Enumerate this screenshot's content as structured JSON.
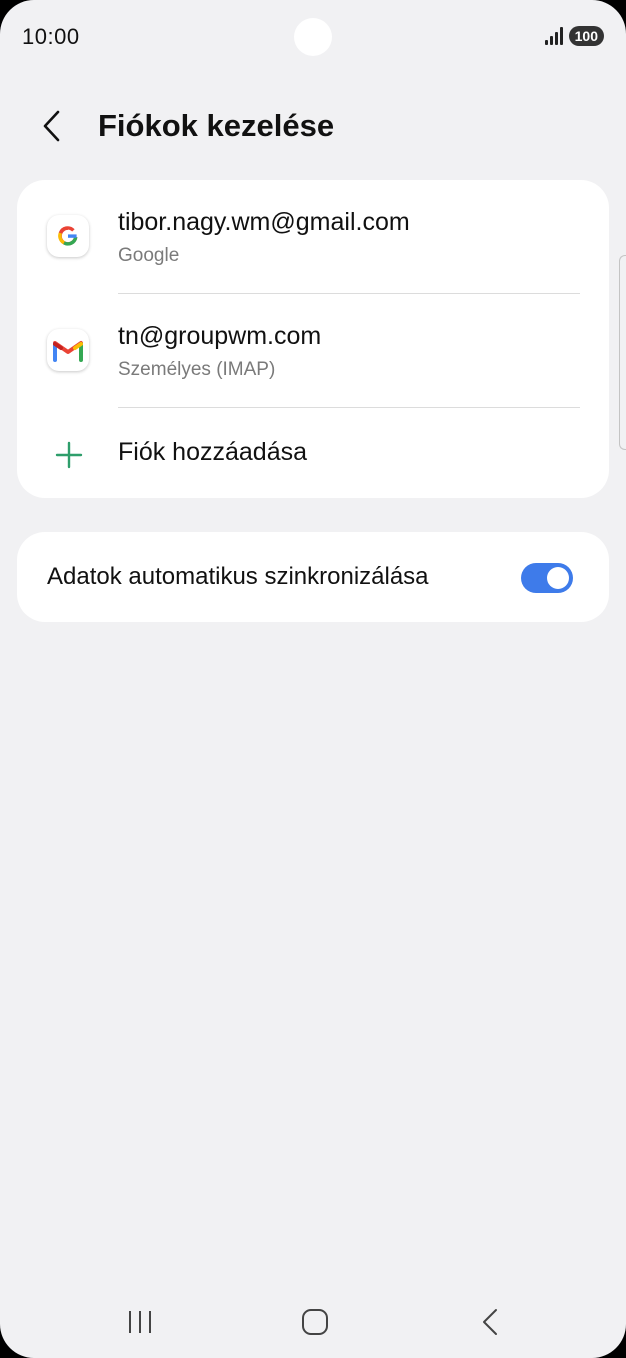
{
  "status_bar": {
    "time": "10:00",
    "battery": "100"
  },
  "header": {
    "title": "Fiókok kezelése",
    "back_icon": "chevron-left-icon"
  },
  "accounts": [
    {
      "email": "tibor.nagy.wm@gmail.com",
      "type": "Google",
      "icon": "google-icon"
    },
    {
      "email": "tn@groupwm.com",
      "type": "Személyes (IMAP)",
      "icon": "gmail-icon"
    }
  ],
  "add_account": {
    "label": "Fiók hozzáadása",
    "icon": "plus-icon",
    "color": "#2e9e6b"
  },
  "sync": {
    "label": "Adatok automatikus szinkronizálása",
    "enabled": true,
    "accent": "#3e7bea"
  },
  "navbar": {
    "recents_icon": "recents-icon",
    "home_icon": "home-icon",
    "back_icon": "back-icon"
  }
}
